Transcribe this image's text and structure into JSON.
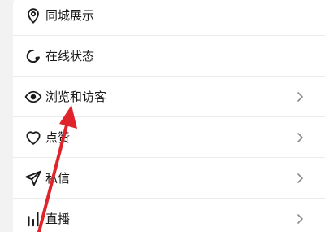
{
  "menu": {
    "items": [
      {
        "label": "同城展示",
        "icon": "location-pin-icon",
        "has_chevron": false
      },
      {
        "label": "在线状态",
        "icon": "online-status-icon",
        "has_chevron": false
      },
      {
        "label": "浏览和访客",
        "icon": "eye-icon",
        "has_chevron": true
      },
      {
        "label": "点赞",
        "icon": "heart-icon",
        "has_chevron": true
      },
      {
        "label": "私信",
        "icon": "send-icon",
        "has_chevron": true
      },
      {
        "label": "直播",
        "icon": "live-bars-icon",
        "has_chevron": true
      }
    ]
  },
  "annotation": {
    "arrow_color": "#e0242b",
    "points_to": "浏览和访客"
  },
  "colors": {
    "background": "#f2f2f2",
    "card": "#ffffff",
    "text": "#1a1a1a",
    "chevron": "#8a8a8a"
  }
}
